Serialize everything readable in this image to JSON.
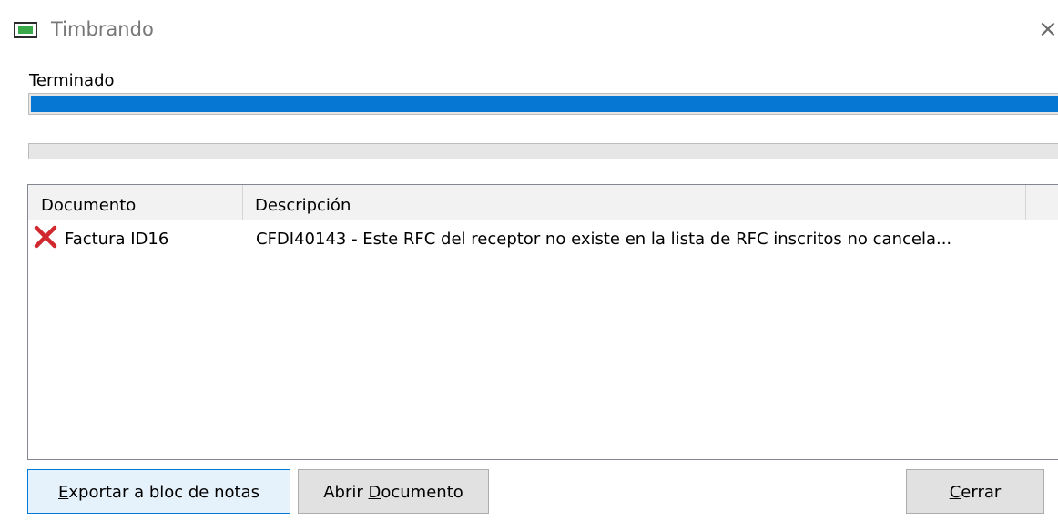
{
  "window": {
    "title": "Timbrando",
    "close_glyph": "×"
  },
  "status": {
    "label": "Terminado",
    "progress_primary": 1.0,
    "progress_secondary": 0.0
  },
  "table": {
    "columns": [
      "Documento",
      "Descripción",
      ""
    ],
    "rows": [
      {
        "status_icon": "error-x-icon",
        "documento": "Factura ID16",
        "descripcion": "CFDI40143 - Este RFC del receptor no existe en la lista de RFC inscritos no cancela..."
      }
    ]
  },
  "buttons": {
    "export": {
      "pre": "",
      "mnemonic": "E",
      "post": "xportar a bloc de notas"
    },
    "open": {
      "pre": "Abrir ",
      "mnemonic": "D",
      "post": "ocumento"
    },
    "close": {
      "pre": "",
      "mnemonic": "C",
      "post": "errar"
    }
  },
  "colors": {
    "progress_fill": "#0678d4",
    "error_icon": "#d1282e",
    "focus_border": "#0078d7"
  }
}
